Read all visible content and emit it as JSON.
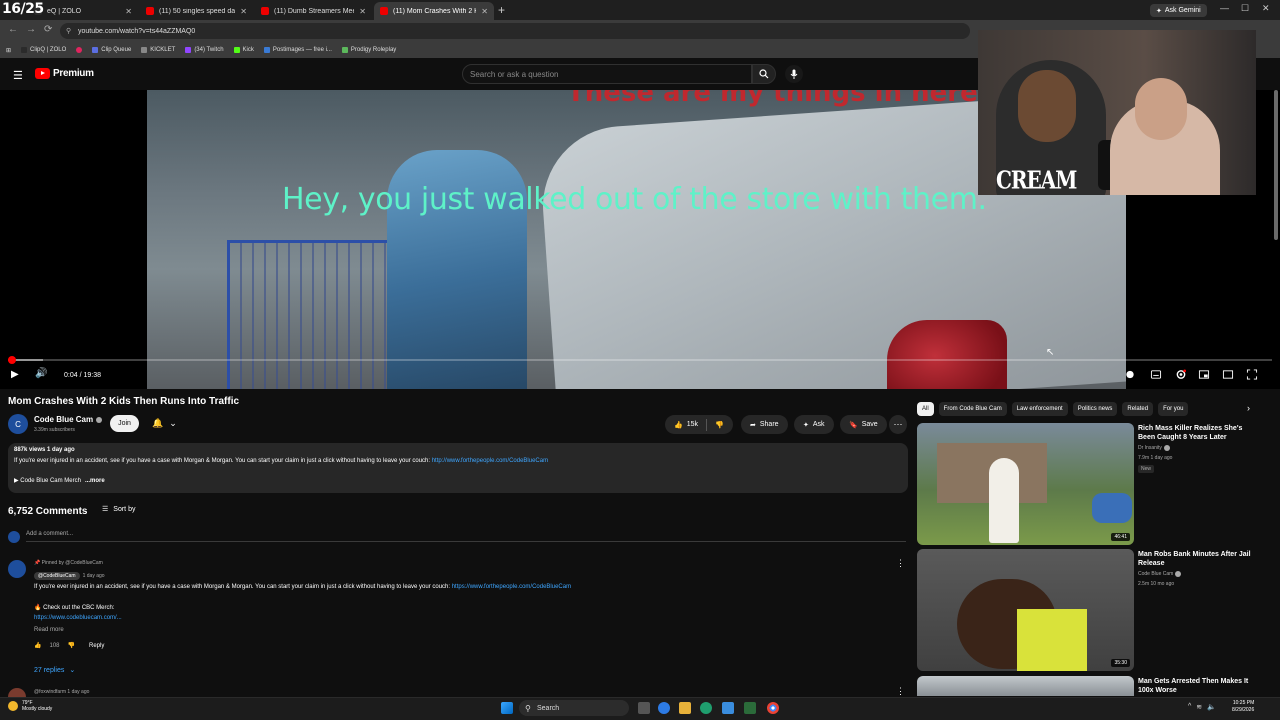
{
  "browser": {
    "tab_counter": "16/25",
    "tabs": [
      {
        "title": "eQ | ZOLO",
        "active": false
      },
      {
        "title": "(11) 50 singles speed date stra",
        "active": false
      },
      {
        "title": "(11) Dumb Streamers Meet Kar",
        "active": false
      },
      {
        "title": "(11) Mom Crashes With 2 Kids",
        "active": true
      }
    ],
    "new_tab": "+",
    "ask_gemini": "Ask Gemini",
    "url": "youtube.com/watch?v=ts44aZZMAQ0",
    "bookmarks": [
      {
        "label": "ClipQ | ZOLO",
        "color": "#2b2b2b"
      },
      {
        "label": "",
        "color": "#e0245e"
      },
      {
        "label": "Clip Queue",
        "color": "#5b6ee1"
      },
      {
        "label": "KICKLET",
        "color": "#888888"
      },
      {
        "label": "(34) Twitch",
        "color": "#9146ff"
      },
      {
        "label": "Kick",
        "color": "#53fc18"
      },
      {
        "label": "Postimages — free i...",
        "color": "#3a7bd5"
      },
      {
        "label": "Prodigy Roleplay",
        "color": "#5cb85c"
      }
    ]
  },
  "youtube": {
    "logo_text": "Premium",
    "search_placeholder": "Search or ask a question"
  },
  "player": {
    "top_caption": "These are my things in here.",
    "subtitle": "Hey, you just walked out of the store with them.",
    "time": "0:04 / 19:38",
    "played_fraction": 0.0034,
    "loaded_fraction": 0.028
  },
  "webcam": {
    "shirt_text": "CREAM"
  },
  "video": {
    "title": "Mom Crashes With 2 Kids Then Runs Into Traffic",
    "channel": "Code Blue Cam",
    "channel_initial": "C",
    "subscribers": "3.39m subscribers",
    "join_label": "Join",
    "likes": "15k",
    "share_label": "Share",
    "ask_label": "Ask",
    "save_label": "Save"
  },
  "description": {
    "meta": "887k views  1 day ago",
    "text": "If you're ever injured in an accident, see if you have a case with Morgan & Morgan. You can start your claim in just a click without having to leave your couch: ",
    "link": "http://www.forthepeople.com/CodeBlueCam",
    "merch": "▶ Code Blue Cam Merch",
    "more": "...more"
  },
  "comments": {
    "count": "6,752 Comments",
    "sort_label": "Sort by",
    "add_placeholder": "Add a comment...",
    "pinned": "Pinned by @CodeBlueCam",
    "author": "@CodeBlueCam",
    "age": "1 day ago",
    "text": "If you're ever injured in an accident, see if you have a case with Morgan & Morgan. You can start your claim in just a click without having to leave your couch: ",
    "text_link": "https://www.forthepeople.com/CodeBlueCam",
    "merch_line": "🔥 Check out the CBC Merch:",
    "merch_link": "https://www.codebluecam.com/...",
    "read_more": "Read more",
    "like_count": "108",
    "reply_label": "Reply",
    "replies": "27 replies",
    "next_author": "@foxwindfarm  1 day ago"
  },
  "chips": [
    "All",
    "From Code Blue Cam",
    "Law enforcement",
    "Politics news",
    "Related",
    "For you"
  ],
  "recommendations": [
    {
      "title": "Rich Mass Killer Realizes She's Been Caught 8 Years Later",
      "channel": "Dr Insanity",
      "meta": "7.9m  1 day ago",
      "badge": "New",
      "duration": "46:41"
    },
    {
      "title": "Man Robs Bank Minutes After Jail Release",
      "channel": "Code Blue Cam",
      "meta": "2.5m  10 mo ago",
      "badge": "",
      "duration": "35:30"
    },
    {
      "title": "Man Gets Arrested Then Makes It 100x Worse",
      "channel": "",
      "meta": "",
      "badge": "",
      "duration": ""
    }
  ],
  "taskbar": {
    "temperature": "79°F",
    "weather": "Mostly cloudy",
    "search_label": "Search",
    "time": "10:25 PM",
    "date": "8/29/2026"
  },
  "colors": {
    "youtube_red": "#ff0000",
    "link_blue": "#3ea6ff",
    "subtitle_teal": "#5ef2c8",
    "background": "#0f0f0f"
  }
}
